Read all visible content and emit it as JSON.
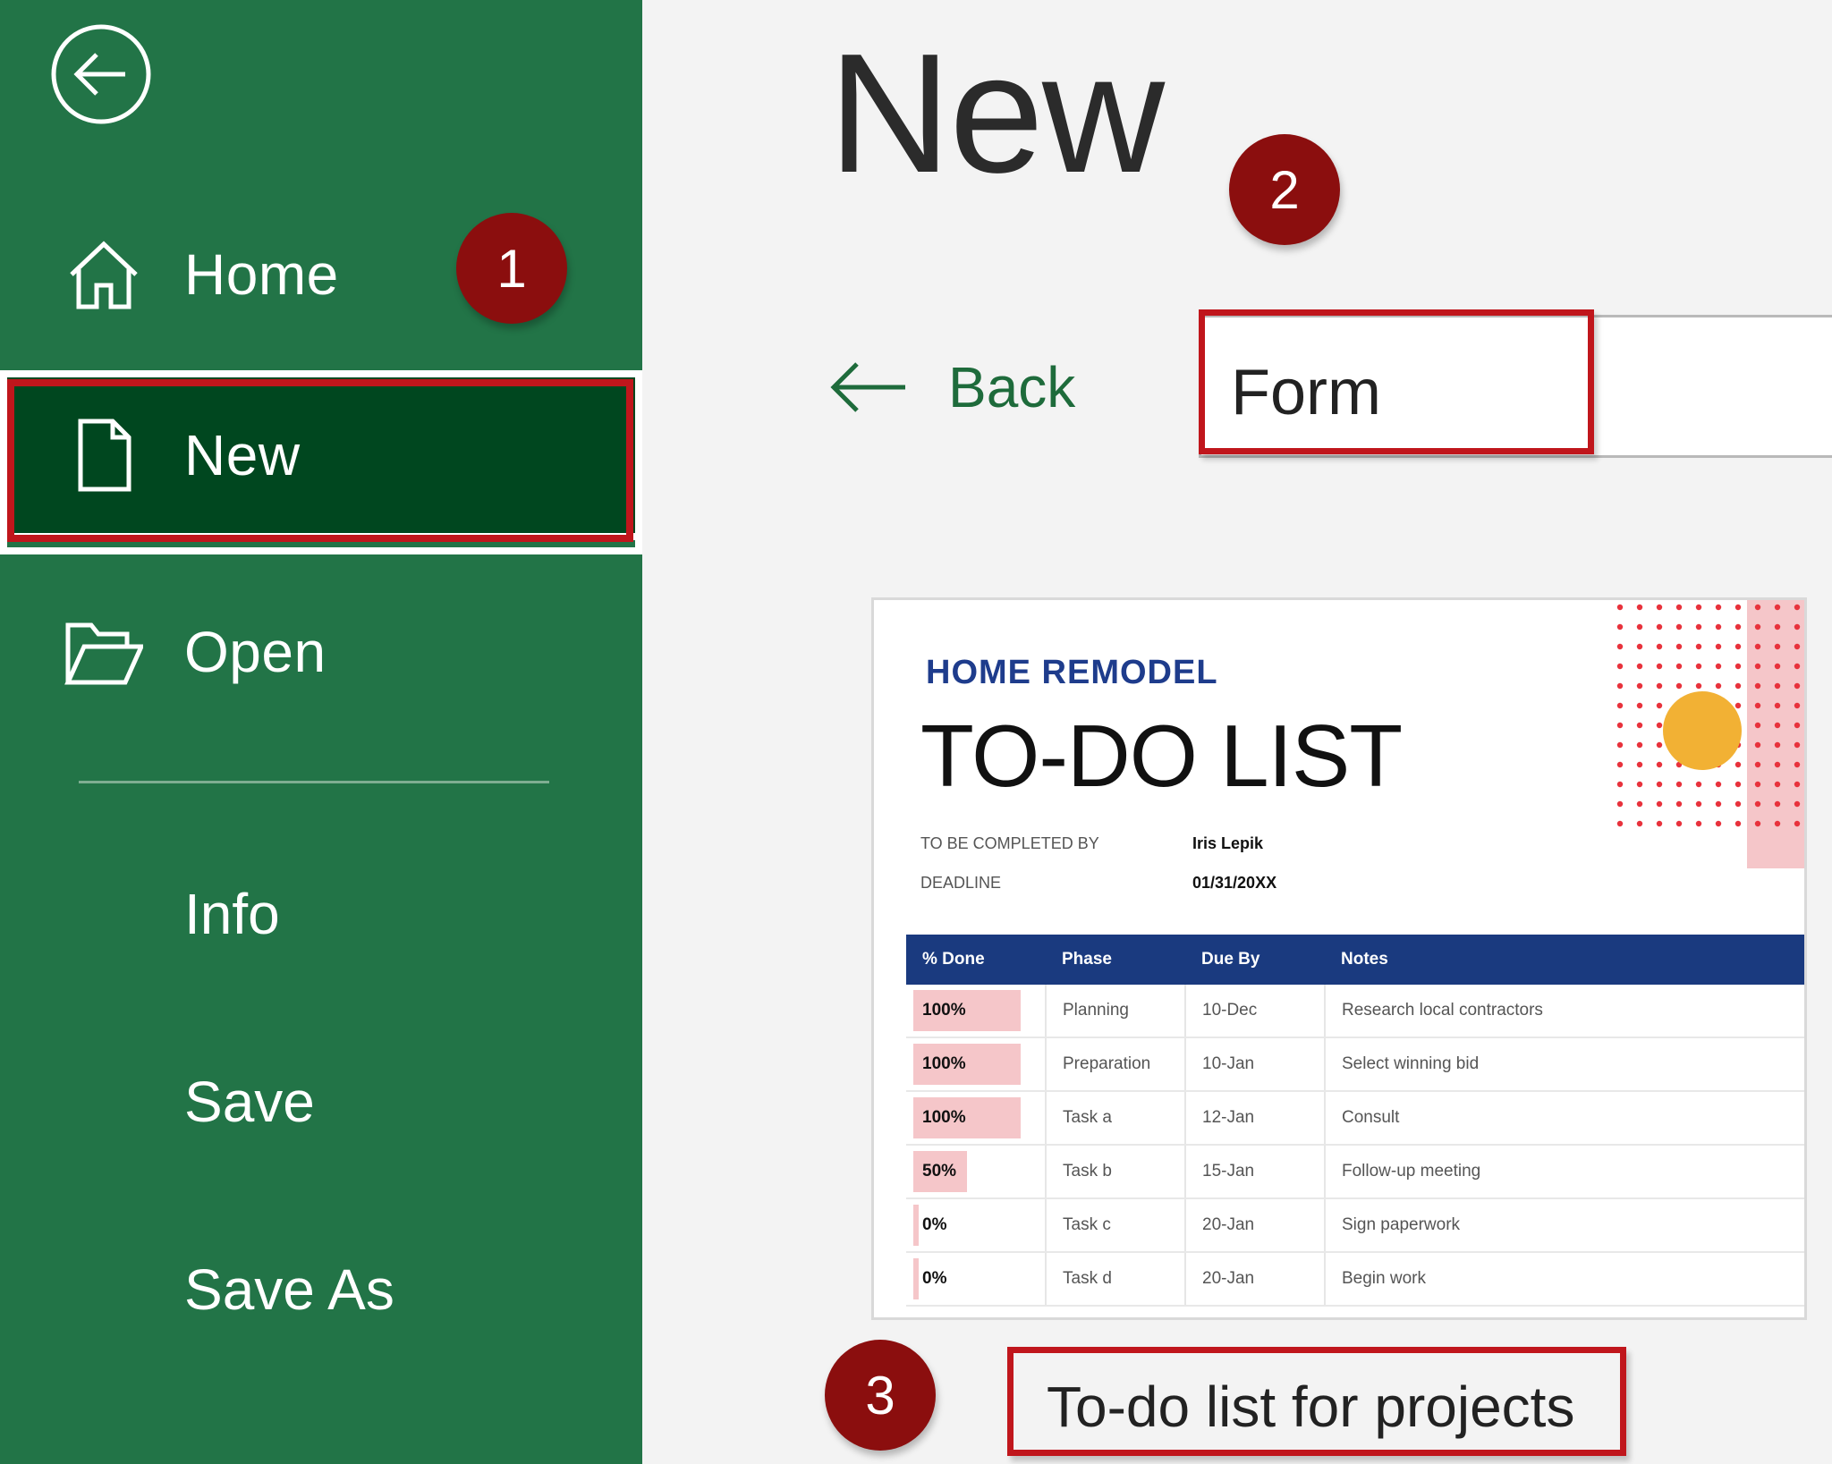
{
  "sidebar": {
    "back_icon": "circle-arrow-left-icon",
    "items": [
      {
        "label": "Home",
        "icon": "home-icon"
      },
      {
        "label": "New",
        "icon": "blank-document-icon",
        "selected": true
      },
      {
        "label": "Open",
        "icon": "open-folder-icon"
      }
    ],
    "plain_items": [
      "Info",
      "Save",
      "Save As"
    ],
    "color_bg": "#227447",
    "color_selected": "#00471f"
  },
  "markers": [
    "1",
    "2",
    "3"
  ],
  "main": {
    "title": "New",
    "back_label": "Back",
    "search_value": "Form"
  },
  "template": {
    "subtitle": "HOME REMODEL",
    "title": "TO-DO LIST",
    "meta": [
      {
        "label": "TO BE COMPLETED BY",
        "value": "Iris Lepik"
      },
      {
        "label": "DEADLINE",
        "value": "01/31/20XX"
      }
    ],
    "columns": [
      "% Done",
      "Phase",
      "Due By",
      "Notes"
    ],
    "rows": [
      {
        "done": "100%",
        "done_fraction": 1.0,
        "phase": "Planning",
        "due": "10-Dec",
        "notes": "Research local contractors"
      },
      {
        "done": "100%",
        "done_fraction": 1.0,
        "phase": "Preparation",
        "due": "10-Jan",
        "notes": "Select winning bid"
      },
      {
        "done": "100%",
        "done_fraction": 1.0,
        "phase": "Task a",
        "due": "12-Jan",
        "notes": "Consult"
      },
      {
        "done": "50%",
        "done_fraction": 0.5,
        "phase": "Task b",
        "due": "15-Jan",
        "notes": "Follow-up meeting"
      },
      {
        "done": "0%",
        "done_fraction": 0.0,
        "phase": "Task c",
        "due": "20-Jan",
        "notes": "Sign paperwork"
      },
      {
        "done": "0%",
        "done_fraction": 0.0,
        "phase": "Task d",
        "due": "20-Jan",
        "notes": "Begin work"
      }
    ],
    "caption": "To-do list for projects",
    "accent_navy": "#1a3a7f",
    "accent_pink": "#f5c6c9",
    "accent_yellow": "#f2b134",
    "accent_red": "#e8323c"
  },
  "highlight_color": "#c0161c"
}
